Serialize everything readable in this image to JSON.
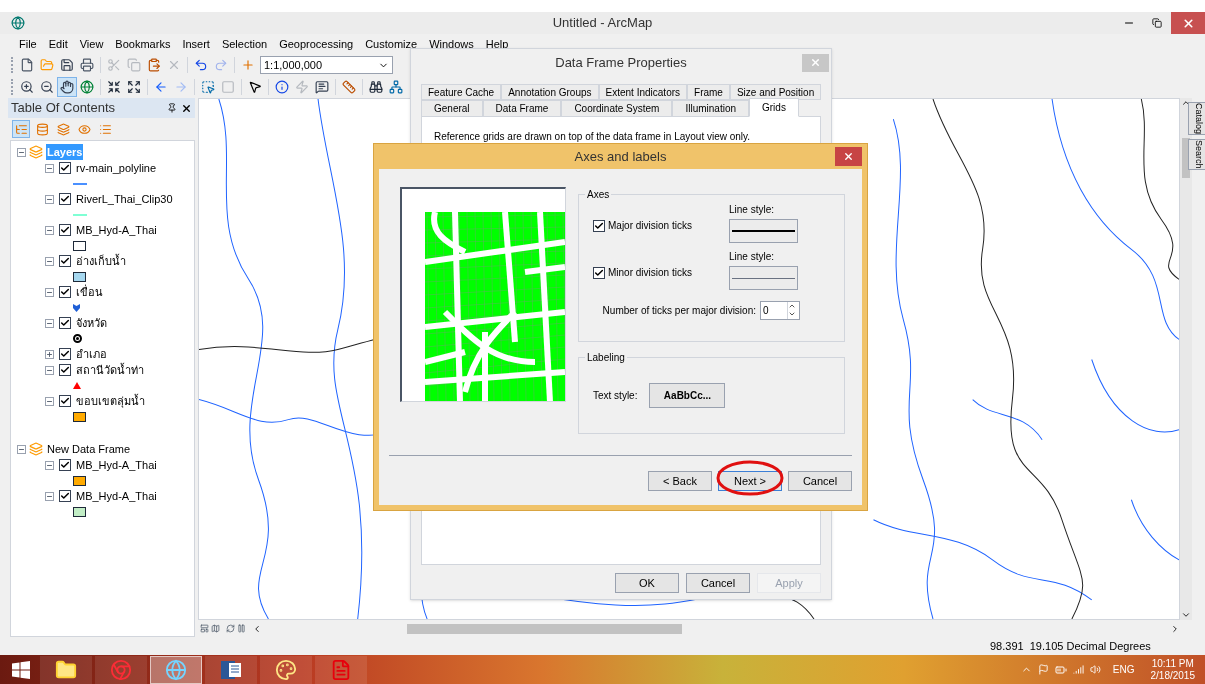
{
  "window": {
    "title": "Untitled - ArcMap"
  },
  "menu": [
    "File",
    "Edit",
    "View",
    "Bookmarks",
    "Insert",
    "Selection",
    "Geoprocessing",
    "Customize",
    "Windows",
    "Help"
  ],
  "toolbars": [
    [
      {
        "kind": "new",
        "disabled": false
      },
      {
        "kind": "open",
        "disabled": false
      },
      {
        "kind": "save",
        "disabled": false
      },
      {
        "kind": "print",
        "disabled": false
      },
      {
        "kind": "separator"
      },
      {
        "kind": "cut",
        "disabled": true
      },
      {
        "kind": "copy",
        "disabled": true
      },
      {
        "kind": "paste",
        "disabled": false
      },
      {
        "kind": "delete",
        "disabled": true
      },
      {
        "kind": "separator"
      },
      {
        "kind": "undo",
        "disabled": false
      },
      {
        "kind": "redo",
        "disabled": true
      },
      {
        "kind": "separator"
      },
      {
        "kind": "add-data",
        "disabled": false
      },
      {
        "kind": "scale",
        "value": "1:1,000,000"
      }
    ],
    [
      {
        "kind": "zoom-in",
        "disabled": false,
        "selected": false
      },
      {
        "kind": "zoom-out",
        "disabled": false,
        "selected": false
      },
      {
        "kind": "pan",
        "disabled": false,
        "selected": true
      },
      {
        "kind": "globe",
        "disabled": false,
        "selected": false
      },
      {
        "kind": "separator"
      },
      {
        "kind": "fixed-zoom-in",
        "disabled": false,
        "selected": false
      },
      {
        "kind": "fixed-zoom-out",
        "disabled": false,
        "selected": false
      },
      {
        "kind": "separator"
      },
      {
        "kind": "back",
        "disabled": false,
        "selected": false
      },
      {
        "kind": "forward",
        "disabled": true,
        "selected": false
      },
      {
        "kind": "separator"
      },
      {
        "kind": "select",
        "disabled": false,
        "selected": false
      },
      {
        "kind": "clear",
        "disabled": true,
        "selected": false
      },
      {
        "kind": "separator"
      },
      {
        "kind": "pointer",
        "disabled": false,
        "selected": false
      },
      {
        "kind": "separator"
      },
      {
        "kind": "identify",
        "disabled": false,
        "selected": false
      },
      {
        "kind": "hyperlink",
        "disabled": true,
        "selected": false
      },
      {
        "kind": "popup",
        "disabled": false,
        "selected": false
      },
      {
        "kind": "separator"
      },
      {
        "kind": "measure",
        "disabled": false,
        "selected": false
      },
      {
        "kind": "separator"
      },
      {
        "kind": "find",
        "disabled": false,
        "selected": false
      },
      {
        "kind": "route",
        "disabled": false,
        "selected": false
      }
    ]
  ],
  "toc": {
    "title": "Table Of Contents",
    "toolbar": [
      {
        "kind": "drawing-order",
        "selected": true
      },
      {
        "kind": "source",
        "selected": false
      },
      {
        "kind": "visibility",
        "selected": false
      },
      {
        "kind": "selection",
        "selected": false
      },
      {
        "kind": "options",
        "selected": false
      }
    ],
    "frames": [
      {
        "name": "Layers",
        "selected": true,
        "expanded": true,
        "children": [
          {
            "name": "rv-main_polyline",
            "checked": true,
            "expanded": true,
            "symbol": {
              "kind": "line",
              "color": "#4a90ff"
            }
          },
          {
            "name": "RiverL_Thai_Clip30",
            "checked": true,
            "expanded": true,
            "symbol": {
              "kind": "line",
              "color": "#7fffd4"
            }
          },
          {
            "name": "MB_Hyd-A_Thai",
            "checked": true,
            "expanded": true,
            "symbol": {
              "kind": "polygon",
              "color": "#ffffff"
            }
          },
          {
            "name": "อ่างเก็บน้ำ",
            "checked": true,
            "expanded": true,
            "symbol": {
              "kind": "polygon",
              "color": "#a6d8f0"
            }
          },
          {
            "name": "เขื่อน",
            "checked": true,
            "expanded": true,
            "symbol": {
              "kind": "shield",
              "color": "#1f5fd6"
            }
          },
          {
            "name": "จังหวัด",
            "checked": true,
            "expanded": true,
            "symbol": {
              "kind": "circle",
              "color": "#000000"
            }
          },
          {
            "name": "อำเภอ",
            "checked": true,
            "expanded": false
          },
          {
            "name": "สถานีวัดน้ำท่า",
            "checked": true,
            "expanded": true,
            "symbol": {
              "kind": "triangle",
              "color": "#ff0000"
            }
          },
          {
            "name": "ขอบเขตลุ่มน้ำ",
            "checked": true,
            "expanded": true,
            "symbol": {
              "kind": "polygon",
              "color": "#ffaa00"
            }
          }
        ]
      },
      {
        "name": "New Data Frame",
        "selected": false,
        "expanded": true,
        "children": [
          {
            "name": "MB_Hyd-A_Thai",
            "checked": true,
            "expanded": true,
            "symbol": {
              "kind": "polygon",
              "color": "#ffaa00"
            }
          },
          {
            "name": "MB_Hyd-A_Thai",
            "checked": true,
            "expanded": true,
            "symbol": {
              "kind": "polygon",
              "color": "#c2eec6"
            }
          }
        ]
      }
    ]
  },
  "side_tabs": [
    "Catalog",
    "Search"
  ],
  "status_bar": {
    "coordinates": "98.391  19.105 Decimal Degrees"
  },
  "data_frame_properties": {
    "title": "Data Frame Properties",
    "tabs_back": [
      {
        "label": "Feature Cache",
        "selected": false
      },
      {
        "label": "Annotation Groups",
        "selected": false
      },
      {
        "label": "Extent Indicators",
        "selected": false
      },
      {
        "label": "Frame",
        "selected": false
      },
      {
        "label": "Size and Position",
        "selected": false
      }
    ],
    "tabs_front": [
      {
        "label": "General",
        "selected": false
      },
      {
        "label": "Data Frame",
        "selected": false
      },
      {
        "label": "Coordinate System",
        "selected": false
      },
      {
        "label": "Illumination",
        "selected": false
      },
      {
        "label": "Grids",
        "selected": true
      }
    ],
    "description": "Reference grids are drawn on top of the data frame in Layout view only.",
    "buttons": [
      {
        "label": "OK",
        "disabled": false
      },
      {
        "label": "Cancel",
        "disabled": false
      },
      {
        "label": "Apply",
        "disabled": true
      }
    ]
  },
  "axes_dialog": {
    "title": "Axes and labels",
    "axes_group": "Axes",
    "ticks": [
      {
        "label": "Major division ticks",
        "checked": true,
        "line_label": "Line style:",
        "kind": "solid"
      },
      {
        "label": "Minor division ticks",
        "checked": true,
        "line_label": "Line style:",
        "kind": "thin"
      }
    ],
    "ticks_per_label": "Number of ticks per major division:",
    "ticks_per_value": "0",
    "labeling_group": "Labeling",
    "text_style_label": "Text style:",
    "text_style_button": "AaBbCc...",
    "buttons": [
      {
        "label": "< Back",
        "circled": false
      },
      {
        "label": "Next >",
        "circled": true
      },
      {
        "label": "Cancel",
        "circled": false
      }
    ]
  },
  "taskbar": {
    "apps": [
      {
        "kind": "explorer",
        "selected": false
      },
      {
        "kind": "chrome",
        "selected": false
      },
      {
        "kind": "arcmap",
        "selected": true
      },
      {
        "kind": "word",
        "selected": false
      },
      {
        "kind": "paint",
        "selected": false
      },
      {
        "kind": "pdf",
        "selected": false
      }
    ],
    "language": "ENG",
    "time": "10:11 PM",
    "date": "2/18/2015"
  }
}
